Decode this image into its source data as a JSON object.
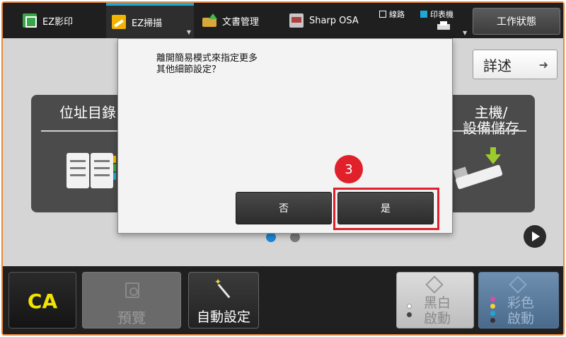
{
  "topbar": {
    "tabs": [
      {
        "label": "EZ影印",
        "icon": "copy-icon"
      },
      {
        "label": "EZ掃描",
        "icon": "scan-icon",
        "active": true
      },
      {
        "label": "文書管理",
        "icon": "folder-icon"
      },
      {
        "label": "Sharp OSA",
        "icon": "osa-icon"
      }
    ],
    "status_line": "線路",
    "status_fax": "印表機",
    "job_status": "工作狀態"
  },
  "main": {
    "detail_label": "詳述",
    "card_left": "位址目錄",
    "card_right": "主機/\n設備儲存"
  },
  "dialog": {
    "message": "離開簡易模式來指定更多\n其他細節設定？",
    "no_label": "否",
    "yes_label": "是",
    "step_number": "3"
  },
  "bottom": {
    "ca_label": "CA",
    "preview_label": "預覽",
    "auto_label": "自動設定",
    "bw_start_label": "黑白\n啟動",
    "color_start_label": "彩色\n啟動"
  },
  "colors": {
    "accent": "#1fa7d8",
    "highlight": "#e0202a",
    "frame": "#e8883a"
  }
}
